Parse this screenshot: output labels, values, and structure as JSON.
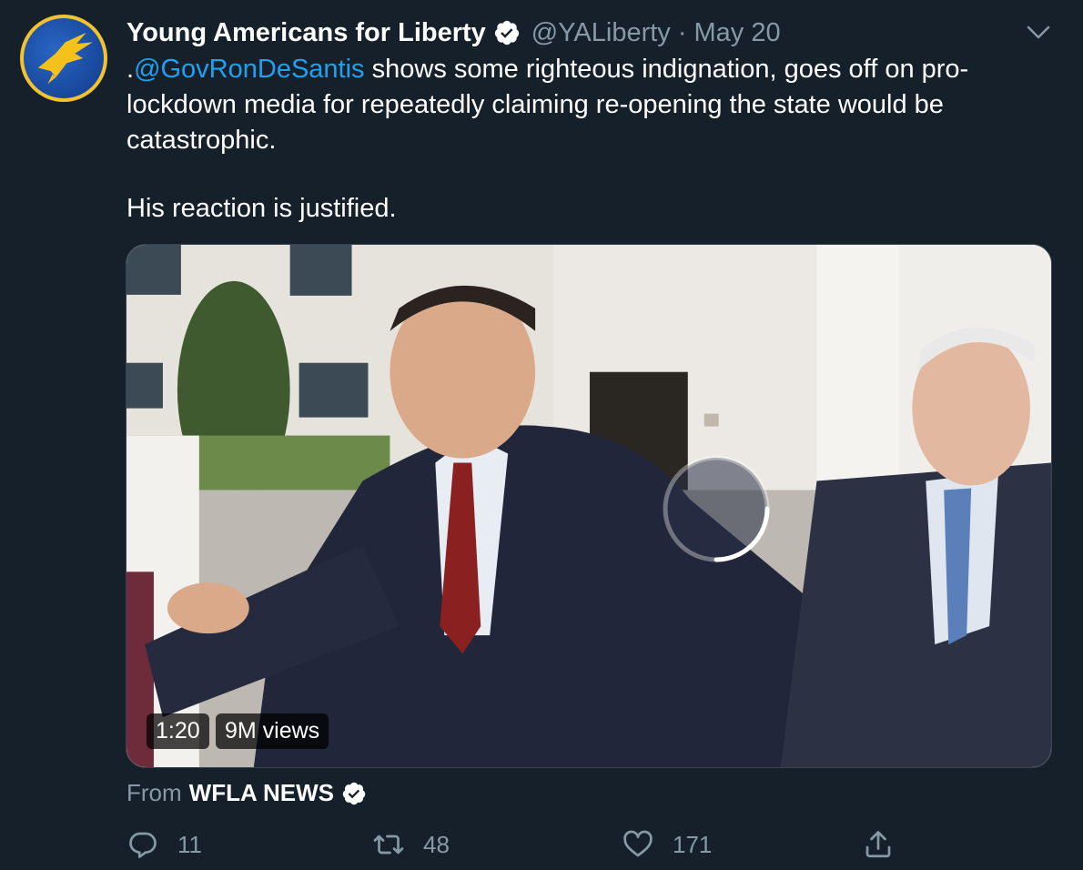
{
  "tweet": {
    "author_name": "Young Americans for Liberty",
    "handle": "@YALiberty",
    "separator": "·",
    "date": "May 20",
    "text_prefix": ".",
    "mention": "@GovRonDeSantis",
    "text_line1": " shows some righteous indignation, goes off on pro-lockdown media for repeatedly claiming re-opening the state would be catastrophic.",
    "text_line2": "His reaction is justified."
  },
  "video": {
    "duration": "1:20",
    "views": "9M views"
  },
  "source": {
    "from_label": "From",
    "name": "WFLA NEWS"
  },
  "actions": {
    "replies": "11",
    "retweets": "48",
    "likes": "171"
  },
  "icons": {
    "verified": "verified-badge-icon",
    "more": "chevron-down-icon",
    "reply": "reply-icon",
    "retweet": "retweet-icon",
    "like": "heart-icon",
    "share": "share-icon",
    "loading": "loading-spinner-icon"
  },
  "colors": {
    "background": "#15202b",
    "accent": "#1da1f2",
    "secondary_text": "#8899a6"
  }
}
